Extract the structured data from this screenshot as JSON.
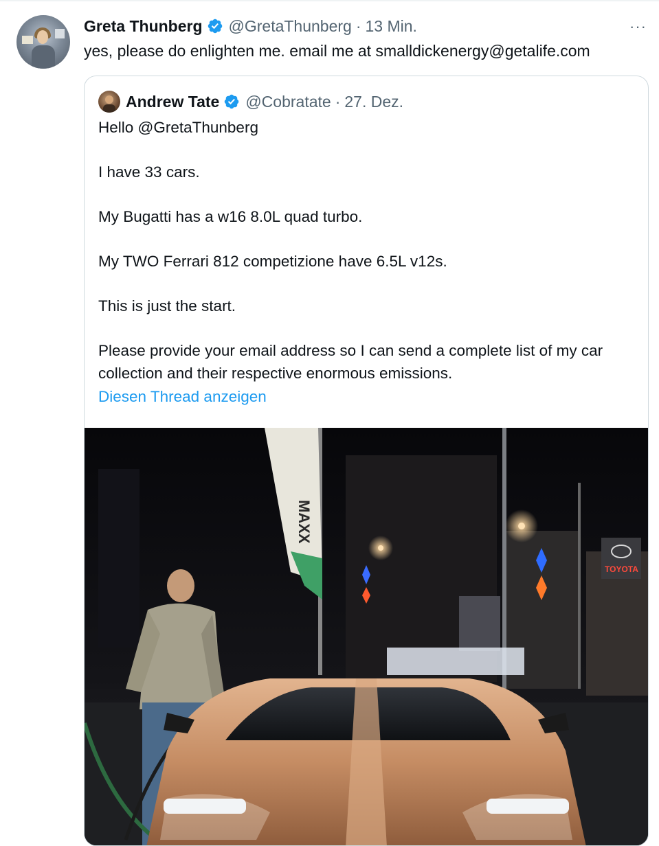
{
  "tweet": {
    "author_name": "Greta Thunberg",
    "author_handle": "@GretaThunberg",
    "separator": "·",
    "time": "13 Min.",
    "more_label": "···",
    "text": "yes, please do enlighten me. email me at smalldickenergy@getalife.com"
  },
  "quoted": {
    "author_name": "Andrew Tate",
    "author_handle": "@Cobratate",
    "separator": "·",
    "time": "27. Dez.",
    "paragraphs": [
      "Hello @GretaThunberg",
      "I have 33 cars.",
      "My Bugatti has a w16 8.0L quad turbo.",
      "My TWO Ferrari 812 competizione have 6.5L v12s.",
      "This is just the start.",
      "Please provide your email address so I can send a complete list of my car collection and their respective enormous emissions."
    ],
    "thread_link": "Diesen Thread anzeigen",
    "photo": {
      "banner_text": "MAXX",
      "dealer_sign": "TOYOTA"
    }
  },
  "colors": {
    "verified": "#1d9bf0",
    "link": "#1d9bf0",
    "secondary_text": "#536471",
    "border": "#cfd9de"
  },
  "icons": [
    "verified-badge-icon",
    "more-options-icon"
  ]
}
